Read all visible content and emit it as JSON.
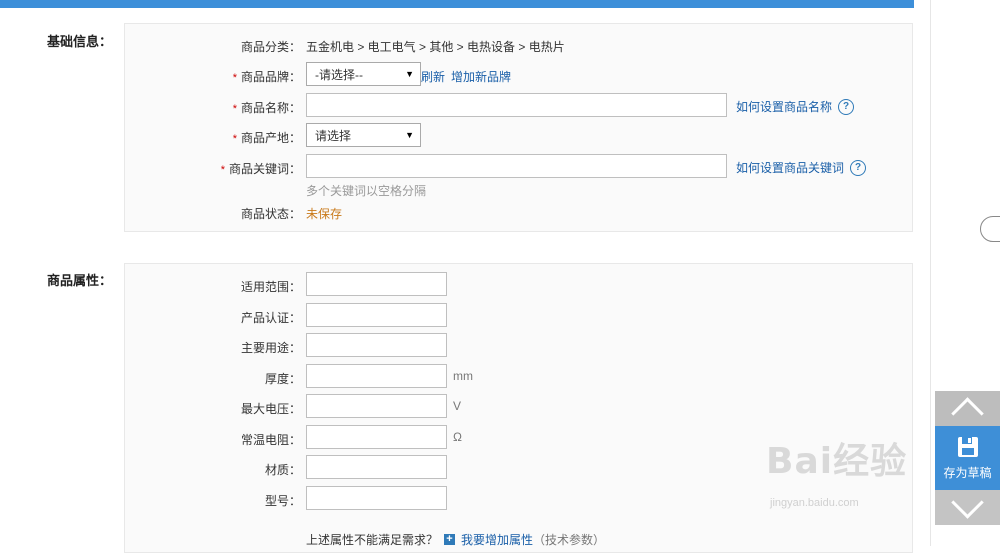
{
  "basic": {
    "section_label": "基础信息：",
    "category_label": "商品分类：",
    "category_path": "五金机电 > 电工电气 > 其他 > 电热设备 > 电热片",
    "brand_label": "商品品牌：",
    "brand_select": "-请选择--",
    "refresh_link": "刷新",
    "add_brand_link": "增加新品牌",
    "name_label": "商品名称：",
    "name_help_link": "如何设置商品名称",
    "origin_label": "商品产地：",
    "origin_select": "请选择",
    "keyword_label": "商品关键词：",
    "keyword_help_link": "如何设置商品关键词",
    "keyword_hint": "多个关键词以空格分隔",
    "status_label": "商品状态：",
    "status_value": "未保存",
    "required_mark": "*"
  },
  "attributes": {
    "section_label": "商品属性：",
    "fields": [
      {
        "label": "适用范围：",
        "unit": ""
      },
      {
        "label": "产品认证：",
        "unit": ""
      },
      {
        "label": "主要用途：",
        "unit": ""
      },
      {
        "label": "厚度：",
        "unit": "mm"
      },
      {
        "label": "最大电压：",
        "unit": "V"
      },
      {
        "label": "常温电阻：",
        "unit": "Ω"
      },
      {
        "label": "材质：",
        "unit": ""
      },
      {
        "label": "型号：",
        "unit": ""
      }
    ],
    "more_prompt": "上述属性不能满足需求？",
    "add_attr_link": "我要增加属性",
    "add_attr_note": "（技术参数）"
  },
  "sidebar": {
    "save_draft": "存为草稿"
  },
  "icons": {
    "help": "question-circle-icon",
    "save": "floppy-disk-icon",
    "up": "chevron-up-icon",
    "down": "chevron-down-icon",
    "plus": "plus-square-icon"
  },
  "colors": {
    "accent": "#3d8fd9",
    "link": "#1a5fa8",
    "required": "#cc0000",
    "status": "#c97a1a"
  }
}
